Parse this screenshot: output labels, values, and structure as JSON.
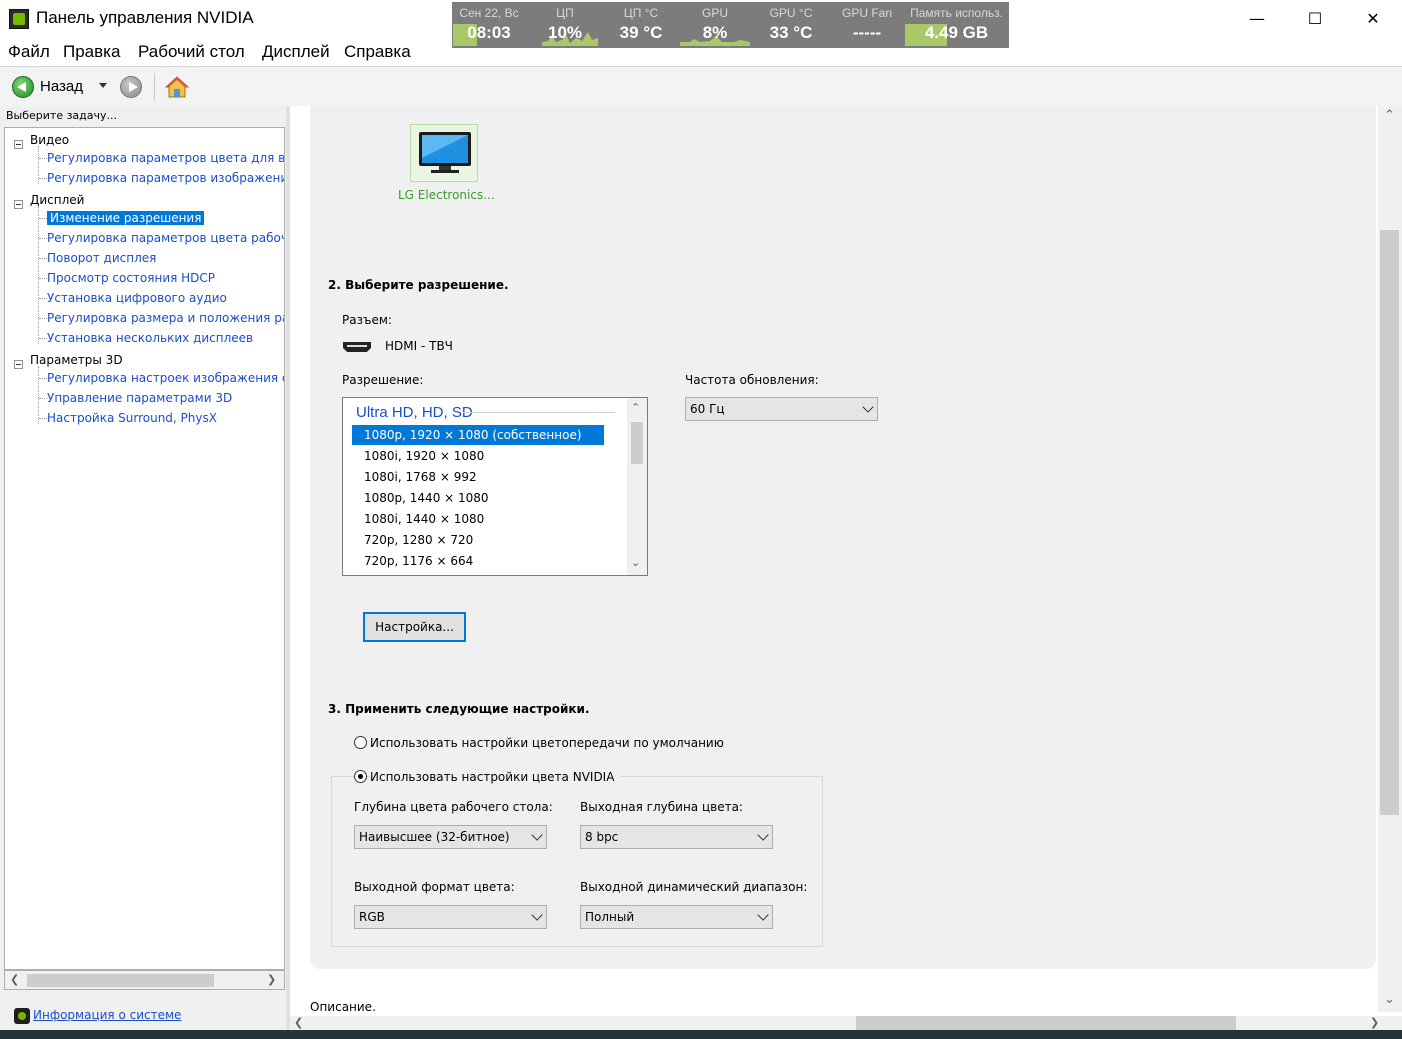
{
  "window": {
    "title": "Панель управления NVIDIA",
    "minimize": "—",
    "maximize": "☐",
    "close": "✕"
  },
  "monitor": {
    "cells": [
      {
        "label": "Сен 22, Вс",
        "value": "08:03"
      },
      {
        "label": "ЦП",
        "value": "10%"
      },
      {
        "label": "ЦП °C",
        "value": "39 °C"
      },
      {
        "label": "GPU",
        "value": "8%"
      },
      {
        "label": "GPU °C",
        "value": "33 °C"
      },
      {
        "label": "GPU Fan",
        "value": "-----"
      },
      {
        "label": "Память использ.",
        "value": "4.49 GB"
      }
    ]
  },
  "menu": [
    "Файл",
    "Правка",
    "Рабочий стол",
    "Дисплей",
    "Справка"
  ],
  "toolbar": {
    "back_label": "Назад"
  },
  "sidebar": {
    "task_label": "Выберите задачу...",
    "categories": [
      {
        "label": "Видео",
        "items": [
          "Регулировка параметров цвета для видео",
          "Регулировка параметров изображения для видео"
        ]
      },
      {
        "label": "Дисплей",
        "items": [
          "Изменение разрешения",
          "Регулировка параметров цвета рабочего стола",
          "Поворот дисплея",
          "Просмотр состояния HDCP",
          "Установка цифрового аудио",
          "Регулировка размера и положения рабочего стола",
          "Установка нескольких дисплеев"
        ]
      },
      {
        "label": "Параметры 3D",
        "items": [
          "Регулировка настроек изображения с просмотром",
          "Управление параметрами 3D",
          "Настройка Surround, PhysX"
        ]
      }
    ],
    "system_info": "Информация о системе"
  },
  "main": {
    "display_name": "LG Electronics...",
    "step2_title": "2. Выберите разрешение.",
    "connector_label": "Разъем:",
    "connector_value": "HDMI - ТВЧ",
    "resolution_label": "Разрешение:",
    "refresh_label": "Частота обновления:",
    "refresh_value": "60 Гц",
    "resolution_group": "Ultra HD, HD, SD",
    "resolutions": [
      "1080p, 1920 × 1080 (собственное)",
      "1080i, 1920 × 1080",
      "1080i, 1768 × 992",
      "1080p, 1440 × 1080",
      "1080i, 1440 × 1080",
      "720p, 1280 × 720",
      "720p, 1176 × 664"
    ],
    "settings_button": "Настройка...",
    "step3_title": "3. Применить следующие настройки.",
    "radio_default": "Использовать настройки цветопередачи по умолчанию",
    "radio_nvidia": "Использовать настройки цвета NVIDIA",
    "desktop_depth_label": "Глубина цвета рабочего стола:",
    "desktop_depth_value": "Наивысшее (32-битное)",
    "output_depth_label": "Выходная глубина цвета:",
    "output_depth_value": "8 bpc",
    "output_format_label": "Выходной формат цвета:",
    "output_format_value": "RGB",
    "dynamic_range_label": "Выходной динамический диапазон:",
    "dynamic_range_value": "Полный",
    "description_label": "Описание."
  }
}
